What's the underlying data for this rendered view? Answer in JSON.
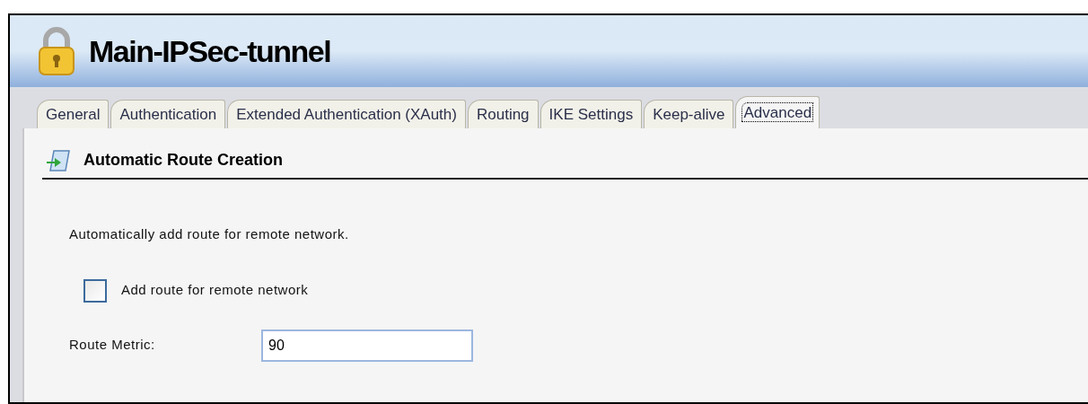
{
  "window": {
    "title": "Main-IPSec-tunnel"
  },
  "tabs": [
    {
      "label": "General",
      "selected": false
    },
    {
      "label": "Authentication",
      "selected": false
    },
    {
      "label": "Extended Authentication (XAuth)",
      "selected": false
    },
    {
      "label": "Routing",
      "selected": false
    },
    {
      "label": "IKE Settings",
      "selected": false
    },
    {
      "label": "Keep-alive",
      "selected": false
    },
    {
      "label": "Advanced",
      "selected": true
    }
  ],
  "section": {
    "title": "Automatic Route Creation",
    "description": "Automatically add route for remote network.",
    "checkbox": {
      "label": "Add route for remote network",
      "checked": false
    },
    "route_metric": {
      "label": "Route Metric:",
      "value": "90"
    }
  }
}
